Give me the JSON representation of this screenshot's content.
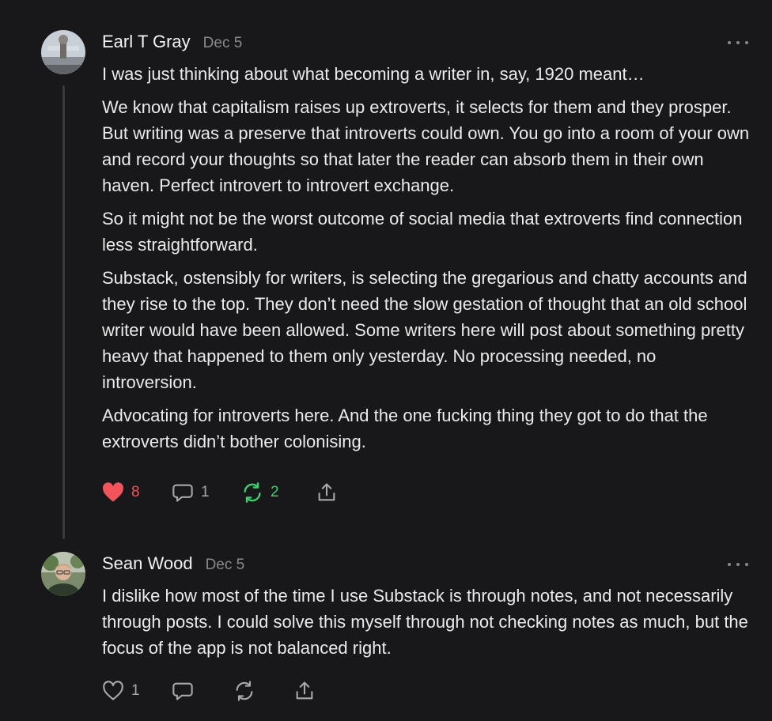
{
  "notes": [
    {
      "author": "Earl T Gray",
      "date": "Dec 5",
      "paragraphs": [
        "I was just thinking about what becoming a writer in, say, 1920 meant…",
        "We know that capitalism raises up extroverts, it selects for them and they prosper. But writing was a preserve that introverts could own. You go into a room of your own and record your thoughts so that later the reader can absorb them in their own haven. Perfect introvert to introvert exchange.",
        "So it might not be the worst outcome of social media that extroverts find connection less straightforward.",
        "Substack, ostensibly for writers, is selecting the gregarious and chatty accounts and they rise to the top. They don’t need the slow gestation of thought that an old school writer would have been allowed. Some writers here will post about something pretty heavy that happened to them only yesterday. No processing needed, no introversion.",
        "Advocating for introverts here. And the one fucking thing they got to do that the extroverts didn’t bother colonising."
      ],
      "likes": "8",
      "comments": "1",
      "restacks": "2",
      "liked": true,
      "restacked": true
    },
    {
      "author": "Sean Wood",
      "date": "Dec 5",
      "paragraphs": [
        "I dislike how most of the time I use Substack is through notes, and not necessarily through posts. I could solve this myself through not checking notes as much, but the focus of the app is not balanced right."
      ],
      "likes": "1",
      "comments": "",
      "restacks": "",
      "liked": false,
      "restacked": false
    }
  ],
  "colors": {
    "background": "#18181a",
    "text": "#ebebeb",
    "muted": "#8a8a8e",
    "like_active": "#f2545b",
    "restack_active": "#3bcf70",
    "icon": "#a8a8ac"
  }
}
